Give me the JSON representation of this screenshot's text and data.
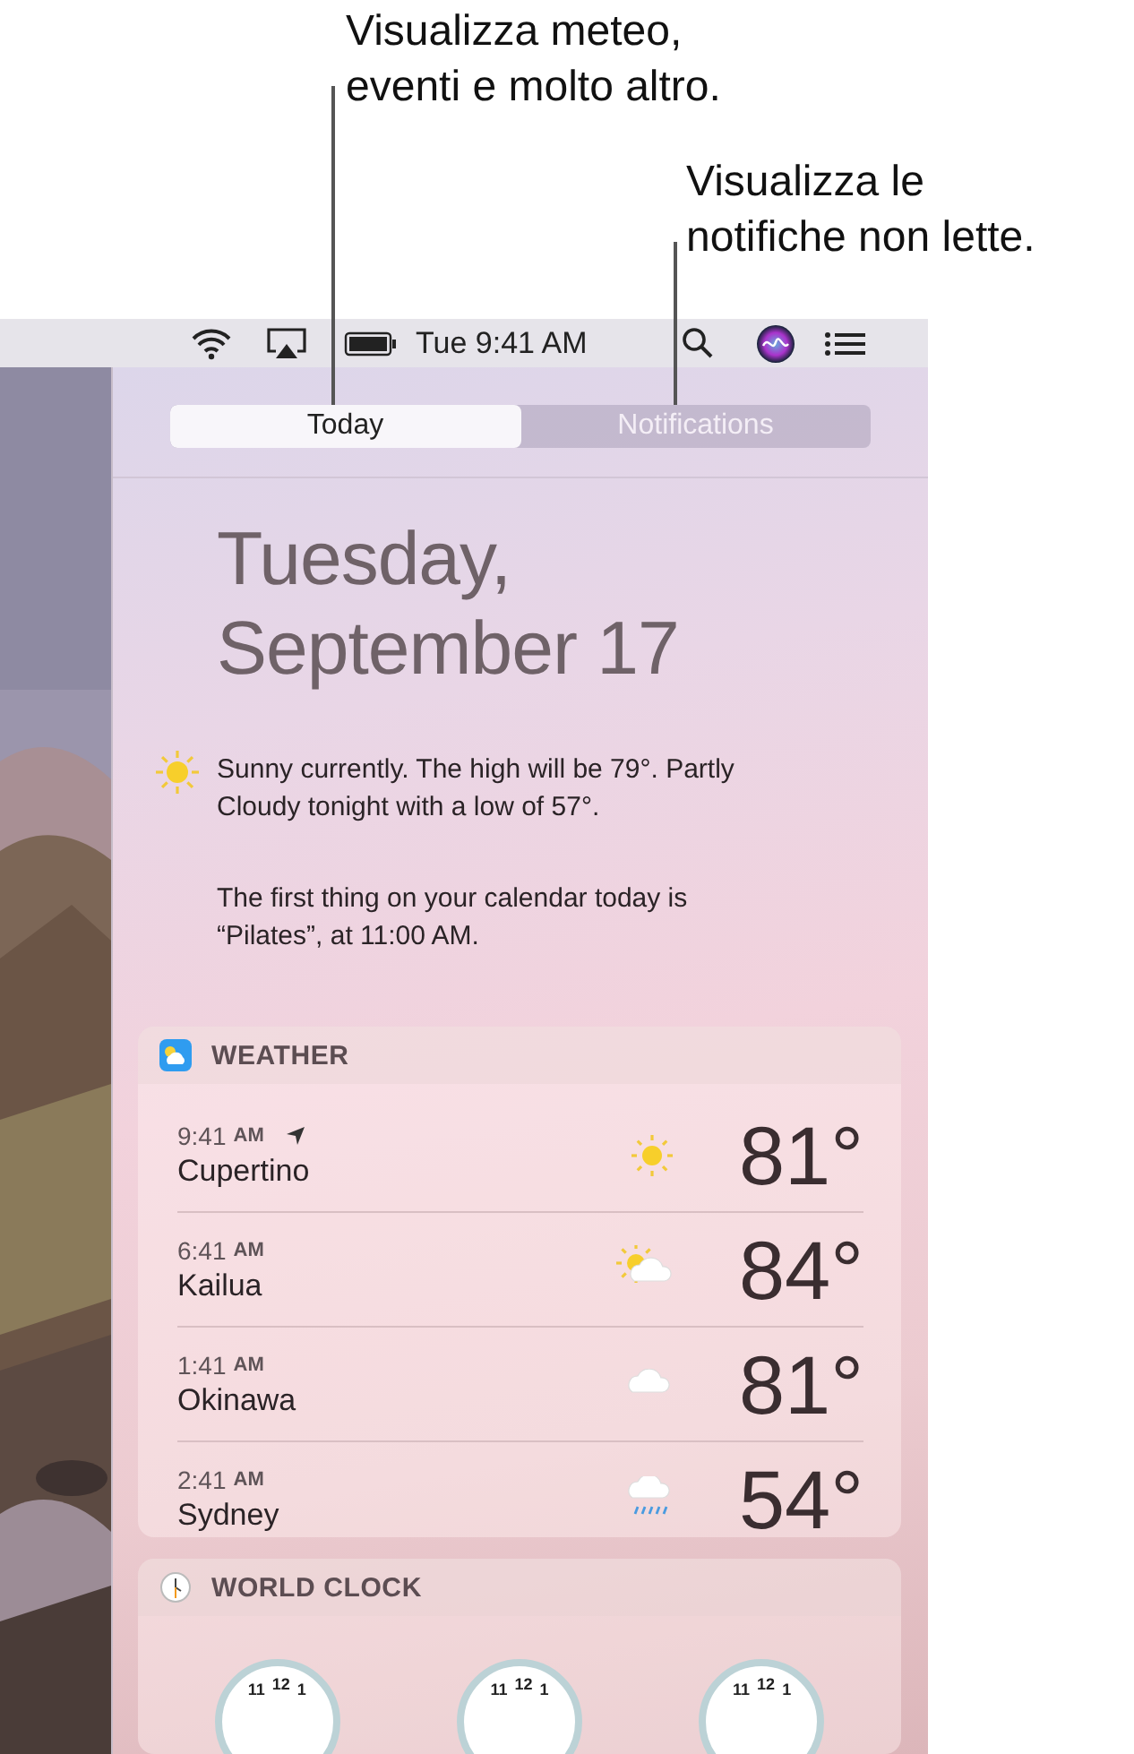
{
  "callouts": [
    {
      "text": "Visualizza meteo,\neventi e molto altro."
    },
    {
      "text": "Visualizza le\nnotifiche non lette."
    }
  ],
  "menu_bar": {
    "clock": "Tue 9:41 AM"
  },
  "tabs": [
    {
      "label": "Today",
      "selected": true
    },
    {
      "label": "Notifications",
      "selected": false
    }
  ],
  "date": {
    "weekday": "Tuesday,",
    "day": "September 17"
  },
  "summary": [
    {
      "kind": "weather",
      "text": "Sunny currently. The high will be 79°. Partly Cloudy tonight with a low of 57°."
    },
    {
      "kind": "calendar",
      "text": "The first thing on your calendar today is “Pilates”, at 11:00 AM."
    }
  ],
  "weather": {
    "title": "WEATHER",
    "rows": [
      {
        "time": "9:41",
        "period": "AM",
        "current_location": true,
        "city": "Cupertino",
        "kind": "sunny",
        "temp": "81°"
      },
      {
        "time": "6:41",
        "period": "AM",
        "current_location": false,
        "city": "Kailua",
        "kind": "partly_cloudy",
        "temp": "84°"
      },
      {
        "time": "1:41",
        "period": "AM",
        "current_location": false,
        "city": "Okinawa",
        "kind": "cloudy",
        "temp": "81°"
      },
      {
        "time": "2:41",
        "period": "AM",
        "current_location": false,
        "city": "Sydney",
        "kind": "rain",
        "temp": "54°"
      }
    ]
  },
  "world_clock": {
    "title": "WORLD CLOCK",
    "clocks": [
      {
        "numerals": [
          "11",
          "12",
          "1"
        ]
      },
      {
        "numerals": [
          "11",
          "12",
          "1"
        ]
      },
      {
        "numerals": [
          "11",
          "12",
          "1"
        ]
      }
    ]
  }
}
